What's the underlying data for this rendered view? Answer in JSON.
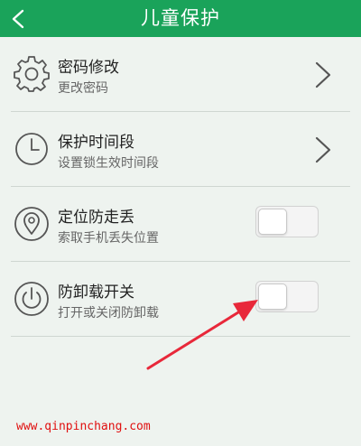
{
  "header": {
    "title": "儿童保护",
    "back_icon": "chevron-left-icon",
    "color": "#1aa35a"
  },
  "items": [
    {
      "label": "密码修改",
      "sub": "更改密码",
      "icon": "gear-icon",
      "control": "chevron"
    },
    {
      "label": "保护时间段",
      "sub": "设置锁生效时间段",
      "icon": "clock-icon",
      "control": "chevron"
    },
    {
      "label": "定位防走丢",
      "sub": "索取手机丢失位置",
      "icon": "location-pin-icon",
      "control": "toggle",
      "on": false
    },
    {
      "label": "防卸载开关",
      "sub": "打开或关闭防卸载",
      "icon": "power-icon",
      "control": "toggle",
      "on": false
    }
  ],
  "annotation": {
    "arrow_color": "#e8283a"
  },
  "watermark": "www.qinpinchang.com"
}
